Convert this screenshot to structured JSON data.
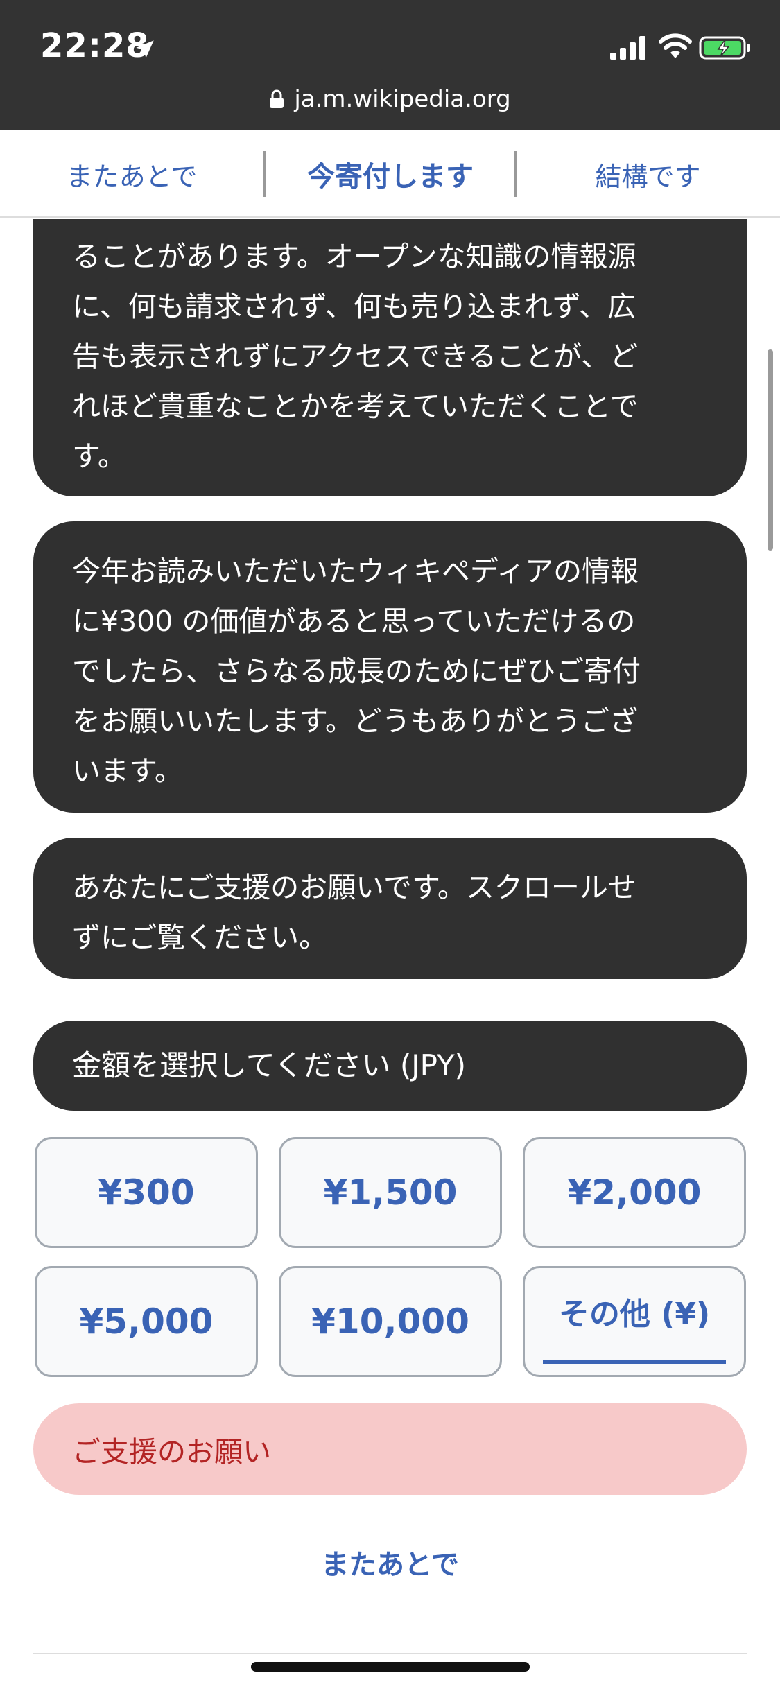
{
  "status_bar": {
    "time": "22:28"
  },
  "browser": {
    "url": "ja.m.wikipedia.org"
  },
  "action_bar": {
    "later_label": "またあとで",
    "donate_label": "今寄付します",
    "decline_label": "結構です"
  },
  "messages": {
    "m1": [
      "ることがあります。オープンな知識の情報源",
      "に、何も請求されず、何も売り込まれず、広",
      "告も表示されずにアクセスできることが、ど",
      "れほど貴重なことかを考えていただくことで",
      "す。"
    ],
    "m2": [
      "今年お読みいただいたウィキペディアの情報",
      "に¥300 の価値があると思っていただけるの",
      "でしたら、さらなる成長のためにぜひご寄付",
      "をお願いいたします。どうもありがとうござ",
      "います。"
    ],
    "m3": [
      "あなたにご支援のお願いです。スクロールせ",
      "ずにご覧ください。"
    ],
    "amount_prompt": "金額を選択してください (JPY)"
  },
  "amounts": [
    "¥300",
    "¥1,500",
    "¥2,000",
    "¥5,000",
    "¥10,000"
  ],
  "other_amount_label": "その他 (¥)",
  "error_message": "ご支援のお願い",
  "footer": {
    "later_link": "またあとで"
  },
  "colors": {
    "accent": "#3a63b5",
    "bubble": "#303030",
    "error_bg": "#f7c9c9",
    "error_text": "#b32424"
  }
}
